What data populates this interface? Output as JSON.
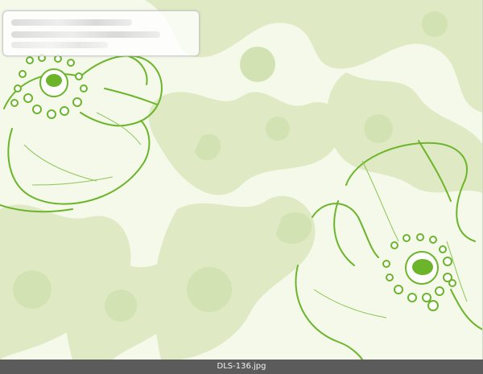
{
  "image": {
    "filename_caption": "DLS-136.jpg"
  },
  "colors": {
    "background": "#f4f9ea",
    "silhouette": "#dfeac4",
    "silhouette_dark": "#d3e2b2",
    "line_green": "#6cb52b",
    "caption_bar": "#5b5b5b",
    "caption_text": "#f2f2f2"
  }
}
